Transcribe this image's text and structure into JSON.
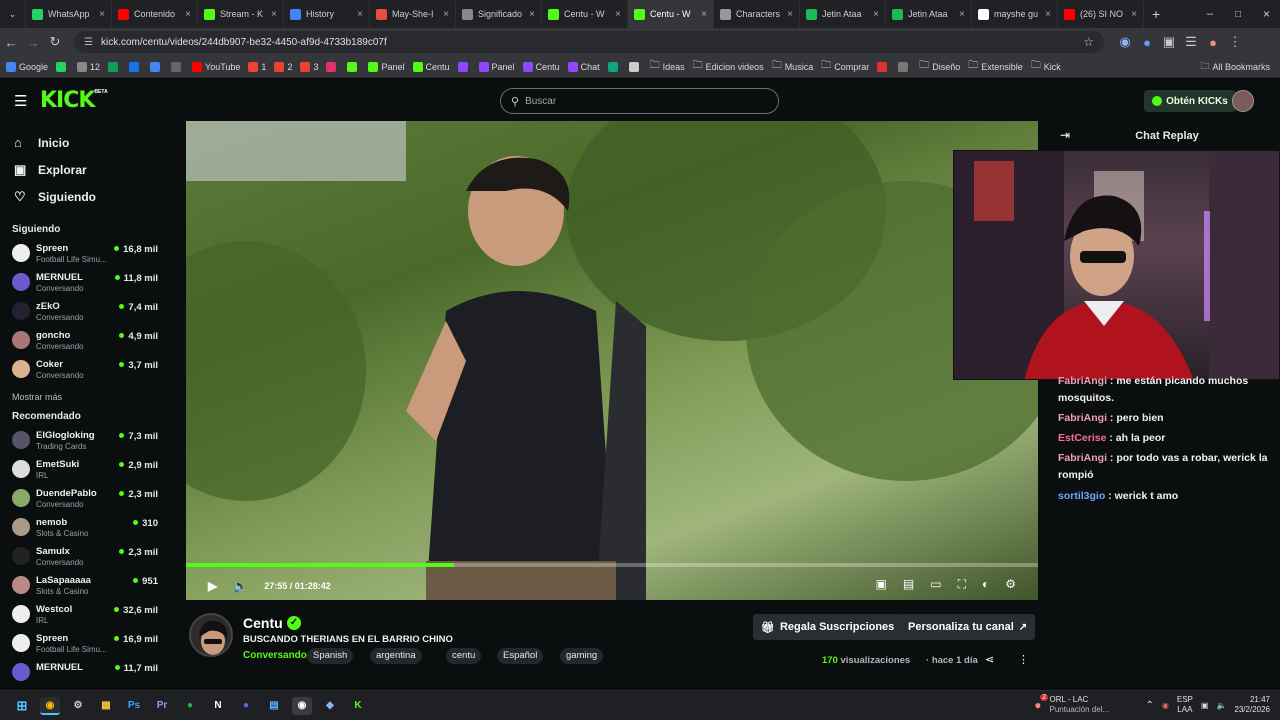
{
  "browser": {
    "tabs": [
      {
        "label": "",
        "color": "#5f6368",
        "icon": "chevron-down-icon"
      },
      {
        "label": "WhatsApp",
        "color": "#25d366",
        "icon": "whatsapp-icon"
      },
      {
        "label": "Contenido",
        "color": "#ff0000",
        "icon": "youtube-icon"
      },
      {
        "label": "Stream - K",
        "color": "#53fc18",
        "icon": "kick-icon"
      },
      {
        "label": "History",
        "color": "#4285f4",
        "icon": "history-icon"
      },
      {
        "label": "May-She-I",
        "color": "#e94e3c",
        "icon": "site-icon"
      },
      {
        "label": "Significado",
        "color": "#888888",
        "icon": "site-icon"
      },
      {
        "label": "Centu - W",
        "color": "#53fc18",
        "icon": "kick-icon"
      },
      {
        "label": "Centu - W",
        "color": "#53fc18",
        "icon": "kick-icon",
        "active": true
      },
      {
        "label": "Characters",
        "color": "#999999",
        "icon": "site-icon"
      },
      {
        "label": "Jetin Ataa",
        "color": "#1db954",
        "icon": "site-icon"
      },
      {
        "label": "Jetin Ataa",
        "color": "#1db954",
        "icon": "site-icon"
      },
      {
        "label": "mayshe gu",
        "color": "#ffffff",
        "icon": "google-icon"
      },
      {
        "label": "(26) SI NO",
        "color": "#ff0000",
        "icon": "youtube-icon"
      }
    ],
    "url": "kick.com/centu/videos/244db907-be32-4450-af9d-4733b189c07f",
    "bookmarks": [
      {
        "label": "Google",
        "color": "#4285f4"
      },
      {
        "label": "",
        "color": "#25d366"
      },
      {
        "label": "12",
        "color": "#888"
      },
      {
        "label": "",
        "color": "#0f9d58"
      },
      {
        "label": "",
        "color": "#1a73e8"
      },
      {
        "label": "",
        "color": "#4285f4"
      },
      {
        "label": "",
        "color": "#666"
      },
      {
        "label": "YouTube",
        "color": "#ff0000"
      },
      {
        "label": "1",
        "color": "#ea4335"
      },
      {
        "label": "2",
        "color": "#ea4335"
      },
      {
        "label": "3",
        "color": "#ea4335"
      },
      {
        "label": "",
        "color": "#e1306c"
      },
      {
        "label": "",
        "color": "#53fc18"
      },
      {
        "label": "Panel",
        "color": "#53fc18"
      },
      {
        "label": "Centu",
        "color": "#53fc18"
      },
      {
        "label": "",
        "color": "#9146ff"
      },
      {
        "label": "Panel",
        "color": "#9146ff"
      },
      {
        "label": "Centu",
        "color": "#9146ff"
      },
      {
        "label": "Chat",
        "color": "#9146ff"
      },
      {
        "label": "",
        "color": "#10a37f"
      },
      {
        "label": "",
        "color": "#ccc"
      },
      {
        "label": "Ideas",
        "color": "folder"
      },
      {
        "label": "Edicion videos",
        "color": "folder"
      },
      {
        "label": "Musica",
        "color": "folder"
      },
      {
        "label": "Comprar",
        "color": "folder"
      },
      {
        "label": "",
        "color": "#d33"
      },
      {
        "label": "",
        "color": "#777"
      },
      {
        "label": "Diseño",
        "color": "folder"
      },
      {
        "label": "Extensible",
        "color": "folder"
      },
      {
        "label": "Kick",
        "color": "folder"
      }
    ],
    "all_bookmarks": "All Bookmarks"
  },
  "kick": {
    "logo": "KICK",
    "logo_badge": "BETA",
    "search_placeholder": "Buscar",
    "kicks_button": "Obtén KICKs",
    "nav": [
      {
        "label": "Inicio",
        "icon": "home-icon"
      },
      {
        "label": "Explorar",
        "icon": "compass-icon"
      },
      {
        "label": "Siguiendo",
        "icon": "heart-icon"
      }
    ],
    "following_title": "Siguiendo",
    "following": [
      {
        "name": "Spreen",
        "sub": "Football Life Simu...",
        "count": "16,8 mil"
      },
      {
        "name": "MERNUEL",
        "sub": "Conversando",
        "count": "11,8 mil"
      },
      {
        "name": "zEkO",
        "sub": "Conversando",
        "count": "7,4 mil"
      },
      {
        "name": "goncho",
        "sub": "Conversando",
        "count": "4,9 mil"
      },
      {
        "name": "Coker",
        "sub": "Conversando",
        "count": "3,7 mil"
      }
    ],
    "show_more": "Mostrar más",
    "recommended_title": "Recomendado",
    "recommended": [
      {
        "name": "ElGlogloking",
        "sub": "Trading Cards",
        "count": "7,3 mil"
      },
      {
        "name": "EmetSuki",
        "sub": "IRL",
        "count": "2,9 mil"
      },
      {
        "name": "DuendePablo",
        "sub": "Conversando",
        "count": "2,3 mil"
      },
      {
        "name": "nemob",
        "sub": "Slots & Casino",
        "count": "310"
      },
      {
        "name": "Samulx",
        "sub": "Conversando",
        "count": "2,3 mil"
      },
      {
        "name": "LaSapaaaaa",
        "sub": "Slots & Casino",
        "count": "951"
      },
      {
        "name": "Westcol",
        "sub": "IRL",
        "count": "32,6 mil"
      },
      {
        "name": "Spreen",
        "sub": "Football Life Simu...",
        "count": "16,9 mil"
      },
      {
        "name": "MERNUEL",
        "sub": "",
        "count": "11,7 mil"
      }
    ]
  },
  "player": {
    "time_current": "27:55",
    "time_total": "01:28:42",
    "progress": 0.315
  },
  "chat": {
    "title": "Chat Replay",
    "messages": [
      {
        "user": "FabriAngi",
        "color": "#f0a0b4",
        "text": "me están picando muchos mosquitos."
      },
      {
        "user": "FabriAngi",
        "color": "#f0a0b4",
        "text": "pero bien"
      },
      {
        "user": "EstCerise",
        "color": "#ff6f8a",
        "text": "ah la peor"
      },
      {
        "user": "FabriAngi",
        "color": "#f0a0b4",
        "text": "por todo vas a robar, werick la rompió"
      },
      {
        "user": "sortil3gio",
        "color": "#6aa9ff",
        "text": "werick t amo"
      }
    ]
  },
  "video_info": {
    "channel": "Centu",
    "title": "BUSCANDO THERIANS EN EL BARRIO CHINO",
    "category": "Conversando",
    "tags": [
      "Spanish",
      "argentina",
      "centu",
      "Español",
      "gaming"
    ],
    "gift_button": "Regala Suscripciones",
    "customize_button": "Personaliza tu canal",
    "views_count": "170",
    "views_label": "visualizaciones",
    "ago": "hace 1 día"
  },
  "taskbar": {
    "weather_title": "ORL - LAC",
    "weather_sub": "Puntuación del...",
    "lang_top": "ESP",
    "lang_bottom": "LAA",
    "time": "21:47",
    "date": "23/2/2026",
    "notification_badge": "2"
  }
}
